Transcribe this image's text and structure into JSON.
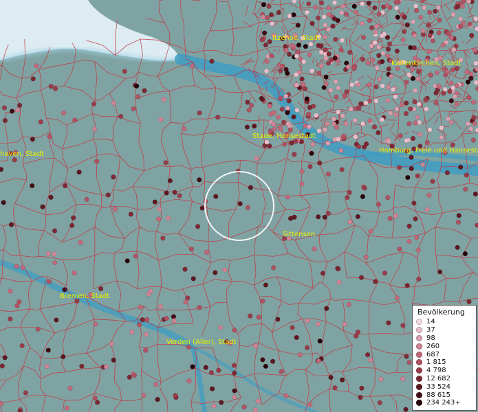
{
  "places": [
    {
      "name": "Itzehoe, Stadt"
    },
    {
      "name": "Kaltenkirchen, Stadt"
    },
    {
      "name": "Stade, Hansestadt"
    },
    {
      "name": "Hamburg, Freie und Hansestadt"
    },
    {
      "name": "Bremerhaven, Stadt",
      "shown": "haven, Stadt"
    },
    {
      "name": "Sittensen"
    },
    {
      "name": "Bremen, Stadt"
    },
    {
      "name": "Verden (Aller), Stadt"
    }
  ],
  "legend": {
    "title": "Bevölkerung",
    "classes": [
      {
        "label": "14",
        "color": "#f4dbe6"
      },
      {
        "label": "37",
        "color": "#e9bfcc"
      },
      {
        "label": "98",
        "color": "#dba1b0"
      },
      {
        "label": "260",
        "color": "#cf8596"
      },
      {
        "label": "687",
        "color": "#c16a7c"
      },
      {
        "label": "1 815",
        "color": "#b05262"
      },
      {
        "label": "4 798",
        "color": "#983c4a"
      },
      {
        "label": "12 682",
        "color": "#7c2833"
      },
      {
        "label": "33 524",
        "color": "#5e1821"
      },
      {
        "label": "88 615",
        "color": "#420c14"
      },
      {
        "label": "234 243",
        "color": "#260308",
        "plus": "+"
      }
    ]
  },
  "map_style": {
    "land_color": "#7fa3a2",
    "water_color": "#3f9cc2",
    "sea_color": "#dcecf2",
    "boundary_color": "#c8303c"
  }
}
